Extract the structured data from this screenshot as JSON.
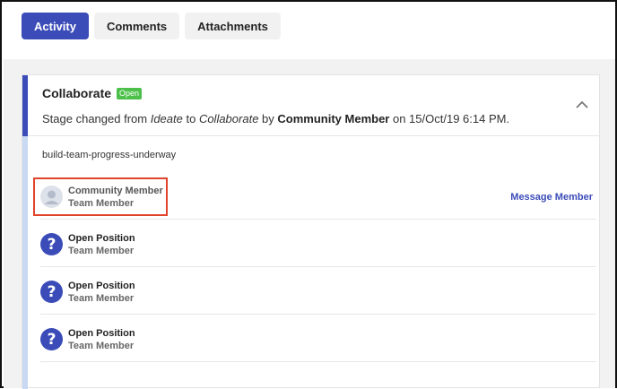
{
  "tabs": [
    {
      "label": "Activity",
      "active": true
    },
    {
      "label": "Comments",
      "active": false
    },
    {
      "label": "Attachments",
      "active": false
    }
  ],
  "card": {
    "title": "Collaborate",
    "status_badge": "Open",
    "stage_prefix": "Stage changed from ",
    "from_stage": "Ideate",
    "to_word": " to ",
    "to_stage": "Collaborate",
    "by_word": " by ",
    "actor": "Community Member",
    "on_text": " on 15/Oct/19 6:14 PM.",
    "tag": "build-team-progress-underway",
    "collapse_icon": "chevron-up-icon"
  },
  "members": [
    {
      "name": "Community Member",
      "role": "Team Member",
      "avatar": "user-silhouette-icon",
      "action": "Message Member"
    },
    {
      "name": "Open Position",
      "role": "Team Member",
      "avatar": "question-mark-icon",
      "avatar_glyph": "?"
    },
    {
      "name": "Open Position",
      "role": "Team Member",
      "avatar": "question-mark-icon",
      "avatar_glyph": "?"
    },
    {
      "name": "Open Position",
      "role": "Team Member",
      "avatar": "question-mark-icon",
      "avatar_glyph": "?"
    }
  ],
  "colors": {
    "accent": "#3b4cb8",
    "badge_green": "#4cc04a",
    "highlight_red": "#e0442a",
    "accent_light": "#c9d8f3"
  }
}
